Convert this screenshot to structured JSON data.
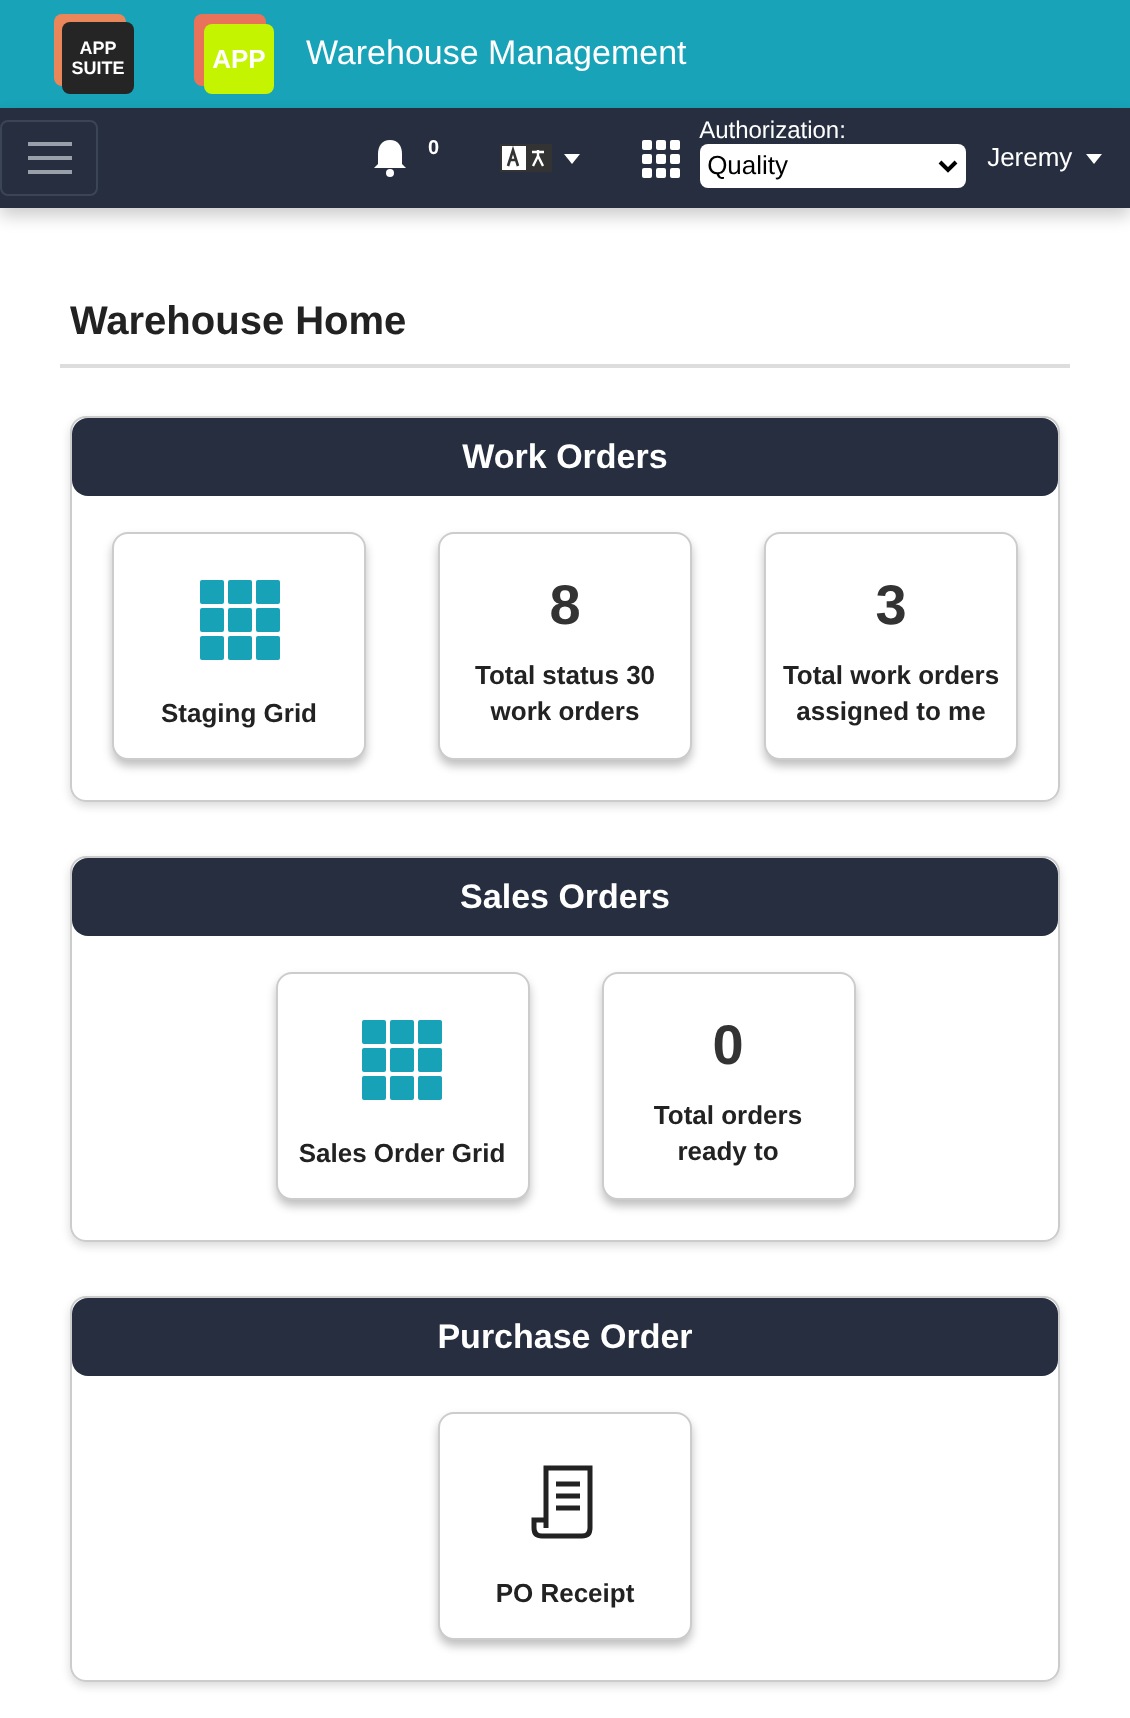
{
  "header": {
    "suite_logo": "APP\nSUITE",
    "app_logo": "APP",
    "title": "Warehouse Management"
  },
  "navbar": {
    "notifications": "0",
    "authorization": {
      "label": "Authorization:",
      "value": "Quality"
    },
    "user": "Jeremy"
  },
  "page_title": "Warehouse Home",
  "sections": [
    {
      "title": "Work Orders",
      "tiles": [
        {
          "kind": "grid",
          "label": "Staging Grid"
        },
        {
          "kind": "count",
          "count": "8",
          "label": "Total status 30 work orders"
        },
        {
          "kind": "count",
          "count": "3",
          "label": "Total work orders assigned to me"
        }
      ]
    },
    {
      "title": "Sales Orders",
      "tiles": [
        {
          "kind": "grid",
          "label": "Sales Order Grid"
        },
        {
          "kind": "count",
          "count": "0",
          "label": "Total orders ready to"
        }
      ]
    },
    {
      "title": "Purchase Order",
      "tiles": [
        {
          "kind": "receipt",
          "label": "PO Receipt"
        }
      ]
    }
  ]
}
